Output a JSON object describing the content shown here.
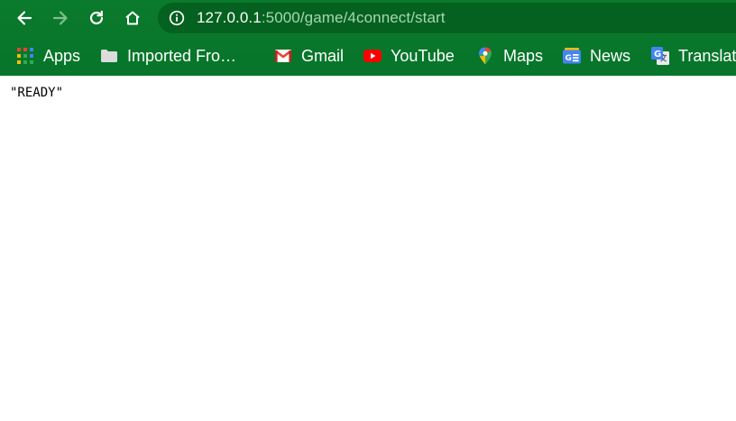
{
  "browser": {
    "address_bar": {
      "host": "127.0.0.1",
      "path": ":5000/game/4connect/start"
    },
    "bookmarks": [
      {
        "label": "Apps",
        "icon": "apps-grid-icon"
      },
      {
        "label": "Imported Fro…",
        "icon": "folder-icon"
      },
      {
        "label": "Gmail",
        "icon": "gmail-icon"
      },
      {
        "label": "YouTube",
        "icon": "youtube-icon"
      },
      {
        "label": "Maps",
        "icon": "maps-icon"
      },
      {
        "label": "News",
        "icon": "google-news-icon"
      },
      {
        "label": "Translate",
        "icon": "google-translate-icon"
      }
    ],
    "colors": {
      "frame": "#0a7a2c",
      "omnibox": "#05611f",
      "url_path": "#a6d7b1"
    }
  },
  "page": {
    "body_text": "\"READY\""
  }
}
